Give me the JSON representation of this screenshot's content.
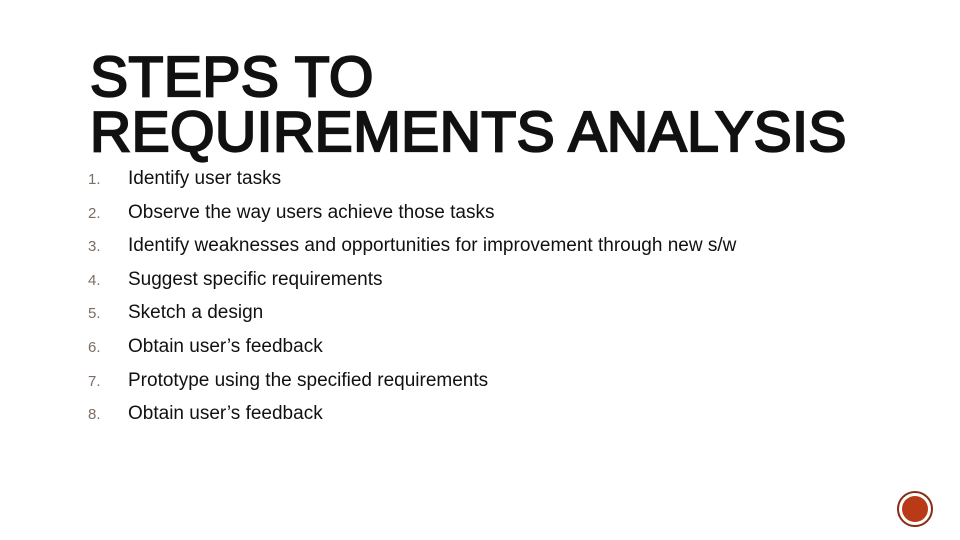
{
  "slide": {
    "title": "Steps to Requirements Analysis",
    "steps": [
      {
        "number": "1.",
        "text": "Identify user tasks"
      },
      {
        "number": "2.",
        "text": "Observe the way users achieve those tasks"
      },
      {
        "number": "3.",
        "text": "Identify weaknesses and opportunities for improvement through new s/w"
      },
      {
        "number": "4.",
        "text": "Suggest specific requirements"
      },
      {
        "number": "5.",
        "text": "Sketch a design"
      },
      {
        "number": "6.",
        "text": "Obtain user’s feedback"
      },
      {
        "number": "7.",
        "text": "Prototype using the specified requirements"
      },
      {
        "number": "8.",
        "text": "Obtain user’s feedback"
      }
    ],
    "badge": {
      "icon": "circle-badge-icon",
      "color": "#b83a17",
      "ring_color": "#8a2a14"
    }
  },
  "colors": {
    "title": "#111111",
    "number": "#7a6e66",
    "text": "#111111"
  }
}
